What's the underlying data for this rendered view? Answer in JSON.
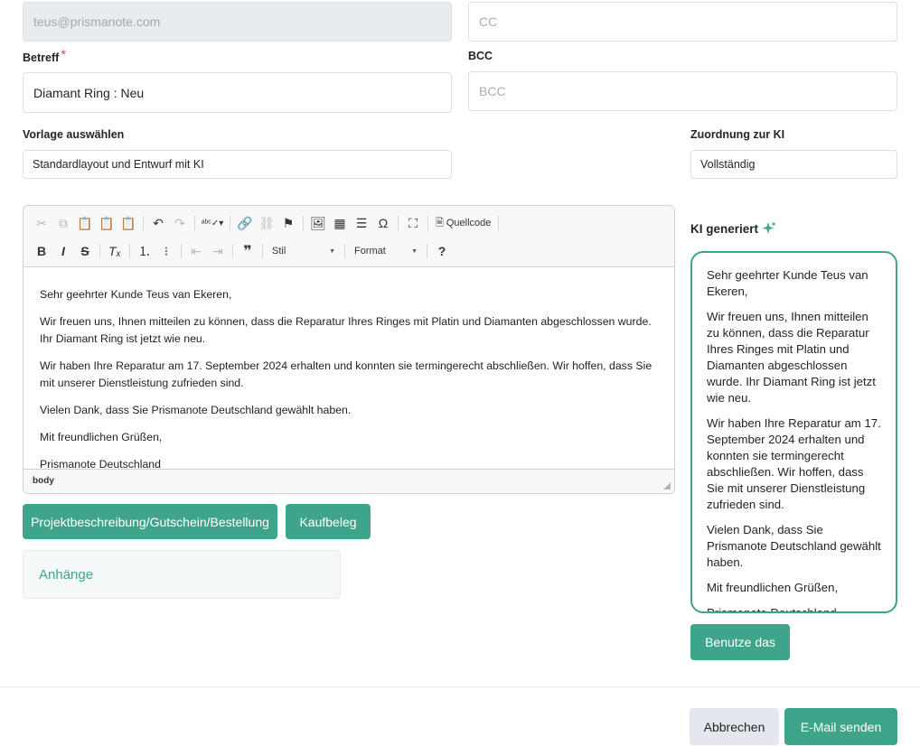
{
  "fields": {
    "from": {
      "value": "teus@prismanote.com"
    },
    "cc": {
      "placeholder": "CC"
    },
    "subject": {
      "label": "Betreff",
      "required": "*",
      "value": "Diamant Ring : Neu"
    },
    "bcc": {
      "label": "BCC",
      "placeholder": "BCC"
    },
    "template": {
      "label": "Vorlage auswählen",
      "value": "Standardlayout und Entwurf mit KI"
    },
    "ai_mapping": {
      "label": "Zuordnung zur KI",
      "value": "Vollständig"
    }
  },
  "editor": {
    "toolbar": {
      "source_label": "Quellcode",
      "style_label": "Stil",
      "format_label": "Format"
    },
    "paragraphs": [
      "Sehr geehrter Kunde Teus van Ekeren,",
      "Wir freuen uns, Ihnen mitteilen zu können, dass die Reparatur Ihres Ringes mit Platin und Diamanten abgeschlossen wurde. Ihr Diamant Ring ist jetzt wie neu.",
      "Wir haben Ihre Reparatur am 17. September 2024 erhalten und konnten sie termingerecht abschließen. Wir hoffen, dass Sie mit unserer Dienstleistung zufrieden sind.",
      "Vielen Dank, dass Sie Prismanote Deutschland gewählt haben.",
      "Mit freundlichen Grüßen,",
      "Prismanote Deutschland"
    ],
    "status": "body"
  },
  "buttons": {
    "project": "Projektbeschreibung/Gutschein/Bestellung",
    "receipt": "Kaufbeleg",
    "use_this": "Benutze das",
    "cancel": "Abbrechen",
    "send": "E-Mail senden"
  },
  "attachments": {
    "label": "Anhänge"
  },
  "ai": {
    "title": "KI generiert",
    "paragraphs": [
      "Sehr geehrter Kunde Teus van Ekeren,",
      "Wir freuen uns, Ihnen mitteilen zu können, dass die Reparatur Ihres Ringes mit Platin und Diamanten abgeschlossen wurde. Ihr Diamant Ring ist jetzt wie neu.",
      "Wir haben Ihre Reparatur am 17. September 2024 erhalten und konnten sie termingerecht abschließen. Wir hoffen, dass Sie mit unserer Dienstleistung zufrieden sind.",
      "Vielen Dank, dass Sie Prismanote Deutschland gewählt haben.",
      "Mit freundlichen Grüßen,",
      "Prismanote Deutschland"
    ]
  },
  "colors": {
    "accent": "#3fa58a",
    "secondary_button": "#e4e7ee",
    "required": "#d9534f"
  }
}
